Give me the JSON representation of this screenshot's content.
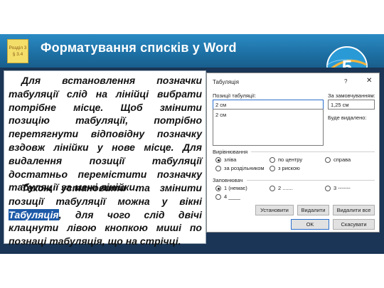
{
  "header": {
    "title": "Форматування списків у Word",
    "section_badge": [
      "Розділ 3",
      "§ 3.4"
    ],
    "grade": "5"
  },
  "text": {
    "para1": "Для встановлення позначки табуляції слід на лінійці вибрати потрібне місце. Щоб змінити позицію табуляції, потрібно перетягнути відповідну позначку вздовж лінійки у нове місце. Для видалення позиції табуляції достатньо перемістити позначку табуляції за межі лінійки.",
    "para2_before": "Також установити та змінити позиції табуляції можна у вікні ",
    "para2_highlight": "Табуляція",
    "para2_after": ", для чого слід двічі клацнути лівою кнопкою миші по познаці табуляція, що на стрічці."
  },
  "dialog": {
    "title": "Табуляція",
    "help": "?",
    "close": "✕",
    "positions_label": "Позиції табуляції:",
    "positions_value": "2 см",
    "positions_list": [
      "2 см"
    ],
    "default_label": "За замовчуванням:",
    "default_value": "1,25 см",
    "remove_label": "Буде видалено:",
    "alignment_label": "Вирівнювання",
    "align_left": "зліва",
    "align_center": "по центру",
    "align_right": "справа",
    "align_decimal": "за роздільником",
    "align_bar": "з рискою",
    "leader_label": "Заповнювач",
    "leader_1": "1 (немає)",
    "leader_2": "2 .......",
    "leader_3": "3 -------",
    "leader_4": "4 ____",
    "btn_set": "Установити",
    "btn_clear": "Видалити",
    "btn_clear_all": "Видалити все",
    "btn_ok": "OK",
    "btn_cancel": "Скасувати"
  },
  "colors": {
    "header_blue": "#1d6fa3",
    "main_navy": "#1a3555",
    "highlight": "#1d5aa8",
    "badge_yellow": "#f3de6a"
  }
}
